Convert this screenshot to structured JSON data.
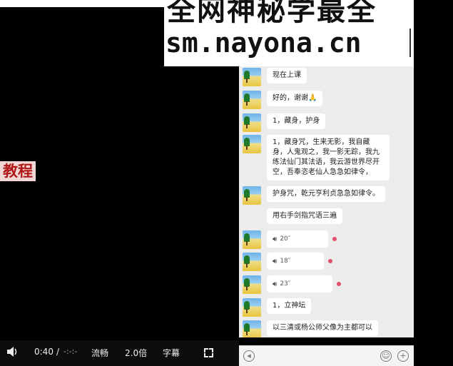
{
  "banner": {
    "line1": "全网神秘学最全",
    "line2": "sm.nayona.cn"
  },
  "video": {
    "overlay_text": "教程"
  },
  "controls": {
    "current_time": "0:40",
    "separator": "/",
    "duration": "-:-:-",
    "quality": "流畅",
    "speed": "2.0倍",
    "subtitles": "字幕"
  },
  "chat": {
    "messages": [
      {
        "type": "text",
        "text": "现在上课"
      },
      {
        "type": "text",
        "text": "好的，谢谢🙏"
      },
      {
        "type": "text",
        "text": "1，藏身，护身"
      },
      {
        "type": "text",
        "text": "1，藏身咒，生来无影，我自藏身，人鬼观之，我一影无踪，我九练法仙门其法语，我云游世界尽开空，吾奉恣老仙人急急如律令，"
      },
      {
        "type": "text",
        "text": "护身咒，乾元亨利贞急急如律令。"
      },
      {
        "type": "text",
        "text": "用右手剑指咒语三遍"
      },
      {
        "type": "voice",
        "duration": "20″",
        "unread": true
      },
      {
        "type": "voice",
        "duration": "18″",
        "unread": true
      },
      {
        "type": "voice",
        "duration": "23″",
        "unread": true
      },
      {
        "type": "text",
        "text": "1，立神坛"
      },
      {
        "type": "text",
        "text": "以三清或杨公师父像为主都可以"
      }
    ]
  },
  "icons": {
    "volume": "volume-icon",
    "fullscreen": "fullscreen-icon",
    "voice_mode": "voice-mode-icon",
    "emoji": "emoji-icon",
    "plus": "plus-icon"
  }
}
